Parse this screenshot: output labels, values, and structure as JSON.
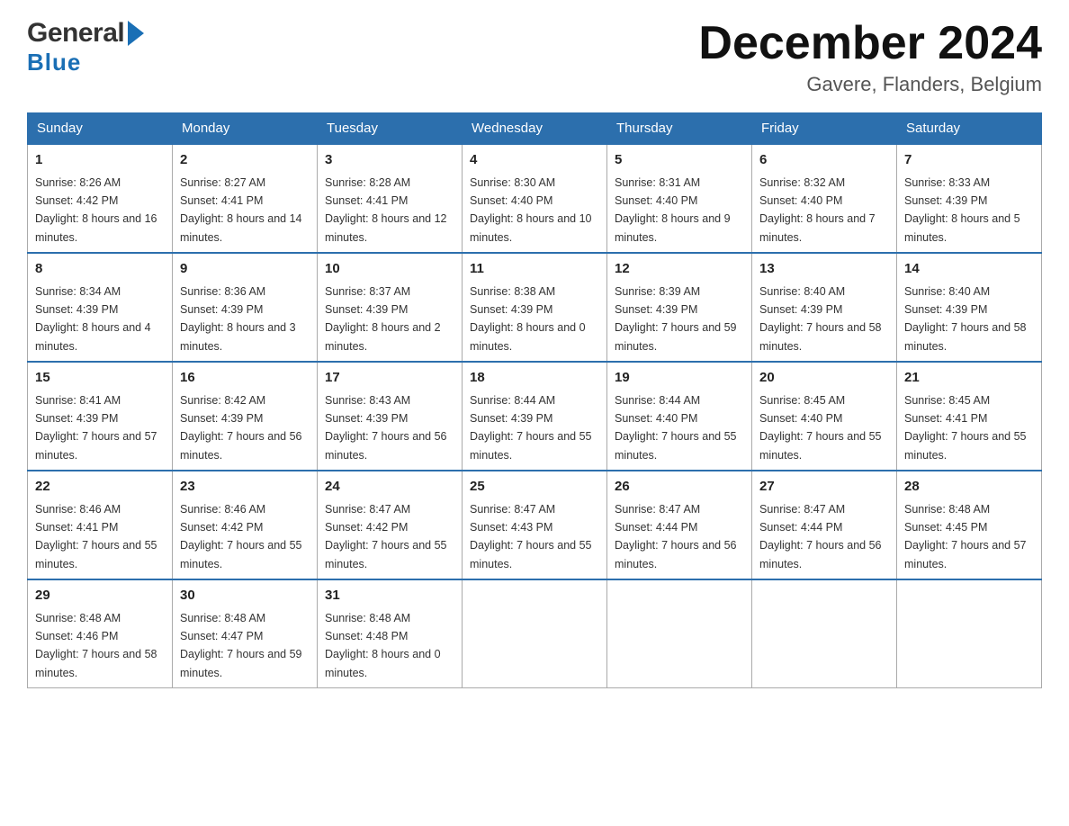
{
  "header": {
    "logo_general": "General",
    "logo_blue": "Blue",
    "month_title": "December 2024",
    "subtitle": "Gavere, Flanders, Belgium"
  },
  "weekdays": [
    "Sunday",
    "Monday",
    "Tuesday",
    "Wednesday",
    "Thursday",
    "Friday",
    "Saturday"
  ],
  "weeks": [
    [
      {
        "day": "1",
        "sunrise": "8:26 AM",
        "sunset": "4:42 PM",
        "daylight": "8 hours and 16 minutes."
      },
      {
        "day": "2",
        "sunrise": "8:27 AM",
        "sunset": "4:41 PM",
        "daylight": "8 hours and 14 minutes."
      },
      {
        "day": "3",
        "sunrise": "8:28 AM",
        "sunset": "4:41 PM",
        "daylight": "8 hours and 12 minutes."
      },
      {
        "day": "4",
        "sunrise": "8:30 AM",
        "sunset": "4:40 PM",
        "daylight": "8 hours and 10 minutes."
      },
      {
        "day": "5",
        "sunrise": "8:31 AM",
        "sunset": "4:40 PM",
        "daylight": "8 hours and 9 minutes."
      },
      {
        "day": "6",
        "sunrise": "8:32 AM",
        "sunset": "4:40 PM",
        "daylight": "8 hours and 7 minutes."
      },
      {
        "day": "7",
        "sunrise": "8:33 AM",
        "sunset": "4:39 PM",
        "daylight": "8 hours and 5 minutes."
      }
    ],
    [
      {
        "day": "8",
        "sunrise": "8:34 AM",
        "sunset": "4:39 PM",
        "daylight": "8 hours and 4 minutes."
      },
      {
        "day": "9",
        "sunrise": "8:36 AM",
        "sunset": "4:39 PM",
        "daylight": "8 hours and 3 minutes."
      },
      {
        "day": "10",
        "sunrise": "8:37 AM",
        "sunset": "4:39 PM",
        "daylight": "8 hours and 2 minutes."
      },
      {
        "day": "11",
        "sunrise": "8:38 AM",
        "sunset": "4:39 PM",
        "daylight": "8 hours and 0 minutes."
      },
      {
        "day": "12",
        "sunrise": "8:39 AM",
        "sunset": "4:39 PM",
        "daylight": "7 hours and 59 minutes."
      },
      {
        "day": "13",
        "sunrise": "8:40 AM",
        "sunset": "4:39 PM",
        "daylight": "7 hours and 58 minutes."
      },
      {
        "day": "14",
        "sunrise": "8:40 AM",
        "sunset": "4:39 PM",
        "daylight": "7 hours and 58 minutes."
      }
    ],
    [
      {
        "day": "15",
        "sunrise": "8:41 AM",
        "sunset": "4:39 PM",
        "daylight": "7 hours and 57 minutes."
      },
      {
        "day": "16",
        "sunrise": "8:42 AM",
        "sunset": "4:39 PM",
        "daylight": "7 hours and 56 minutes."
      },
      {
        "day": "17",
        "sunrise": "8:43 AM",
        "sunset": "4:39 PM",
        "daylight": "7 hours and 56 minutes."
      },
      {
        "day": "18",
        "sunrise": "8:44 AM",
        "sunset": "4:39 PM",
        "daylight": "7 hours and 55 minutes."
      },
      {
        "day": "19",
        "sunrise": "8:44 AM",
        "sunset": "4:40 PM",
        "daylight": "7 hours and 55 minutes."
      },
      {
        "day": "20",
        "sunrise": "8:45 AM",
        "sunset": "4:40 PM",
        "daylight": "7 hours and 55 minutes."
      },
      {
        "day": "21",
        "sunrise": "8:45 AM",
        "sunset": "4:41 PM",
        "daylight": "7 hours and 55 minutes."
      }
    ],
    [
      {
        "day": "22",
        "sunrise": "8:46 AM",
        "sunset": "4:41 PM",
        "daylight": "7 hours and 55 minutes."
      },
      {
        "day": "23",
        "sunrise": "8:46 AM",
        "sunset": "4:42 PM",
        "daylight": "7 hours and 55 minutes."
      },
      {
        "day": "24",
        "sunrise": "8:47 AM",
        "sunset": "4:42 PM",
        "daylight": "7 hours and 55 minutes."
      },
      {
        "day": "25",
        "sunrise": "8:47 AM",
        "sunset": "4:43 PM",
        "daylight": "7 hours and 55 minutes."
      },
      {
        "day": "26",
        "sunrise": "8:47 AM",
        "sunset": "4:44 PM",
        "daylight": "7 hours and 56 minutes."
      },
      {
        "day": "27",
        "sunrise": "8:47 AM",
        "sunset": "4:44 PM",
        "daylight": "7 hours and 56 minutes."
      },
      {
        "day": "28",
        "sunrise": "8:48 AM",
        "sunset": "4:45 PM",
        "daylight": "7 hours and 57 minutes."
      }
    ],
    [
      {
        "day": "29",
        "sunrise": "8:48 AM",
        "sunset": "4:46 PM",
        "daylight": "7 hours and 58 minutes."
      },
      {
        "day": "30",
        "sunrise": "8:48 AM",
        "sunset": "4:47 PM",
        "daylight": "7 hours and 59 minutes."
      },
      {
        "day": "31",
        "sunrise": "8:48 AM",
        "sunset": "4:48 PM",
        "daylight": "8 hours and 0 minutes."
      },
      null,
      null,
      null,
      null
    ]
  ],
  "labels": {
    "sunrise": "Sunrise:",
    "sunset": "Sunset:",
    "daylight": "Daylight:"
  }
}
